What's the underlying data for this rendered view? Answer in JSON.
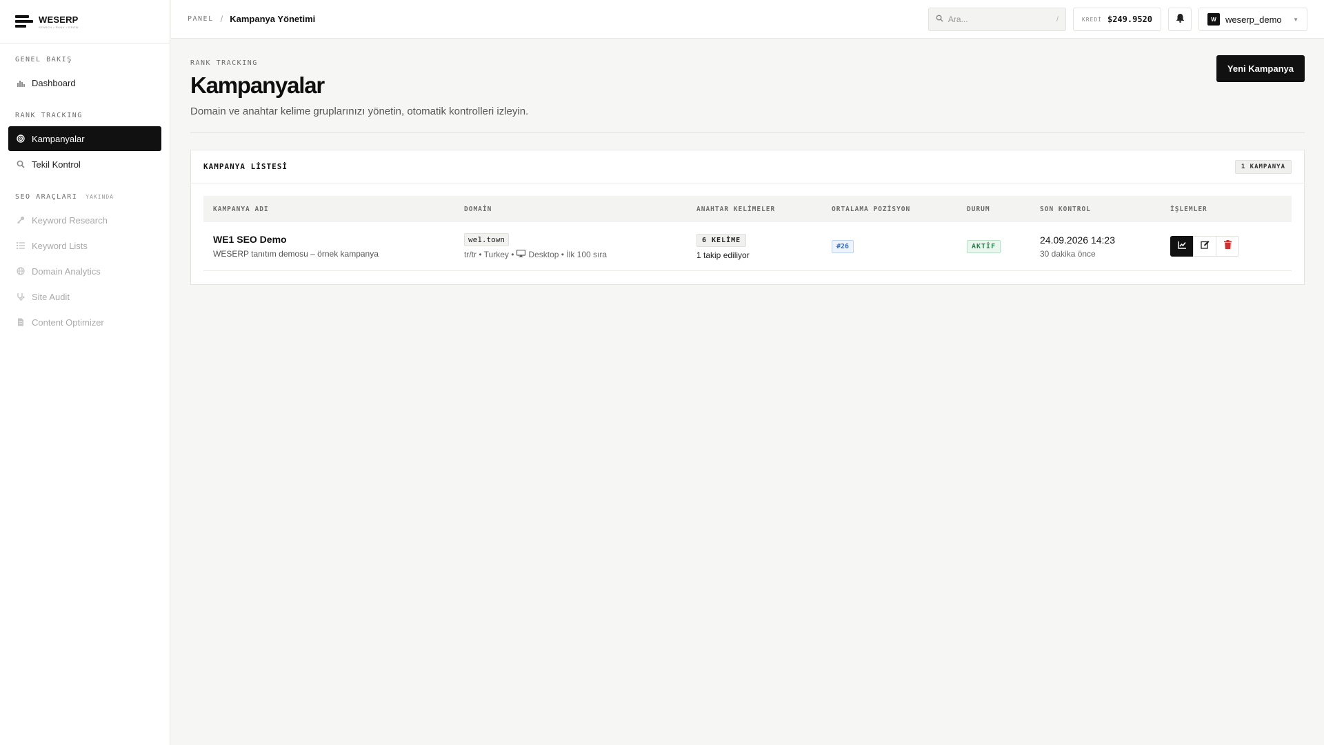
{
  "brand": {
    "name": "WESERP",
    "tagline": "SEARCH • RANK • GROW"
  },
  "sidebar": {
    "sections": [
      {
        "label": "GENEL BAKIŞ",
        "items": [
          {
            "label": "Dashboard",
            "icon": "bar-chart-icon"
          }
        ]
      },
      {
        "label": "RANK TRACKING",
        "items": [
          {
            "label": "Kampanyalar",
            "icon": "target-icon",
            "active": true
          },
          {
            "label": "Tekil Kontrol",
            "icon": "search-icon"
          }
        ]
      },
      {
        "label": "SEO ARAÇLARI",
        "badge": "YAKINDA",
        "items": [
          {
            "label": "Keyword Research",
            "icon": "key-icon"
          },
          {
            "label": "Keyword Lists",
            "icon": "list-icon"
          },
          {
            "label": "Domain Analytics",
            "icon": "globe-icon"
          },
          {
            "label": "Site Audit",
            "icon": "stethoscope-icon"
          },
          {
            "label": "Content Optimizer",
            "icon": "document-icon"
          }
        ]
      }
    ]
  },
  "topbar": {
    "breadcrumb_root": "PANEL",
    "breadcrumb_sep": "/",
    "breadcrumb_current": "Kampanya Yönetimi",
    "search_placeholder": "Ara...",
    "search_shortcut": "/",
    "credit_label": "KREDİ",
    "credit_value": "$249.9520",
    "user_initial": "W",
    "user_name": "weserp_demo"
  },
  "page": {
    "eyebrow": "RANK TRACKING",
    "title": "Kampanyalar",
    "description": "Domain ve anahtar kelime gruplarınızı yönetin, otomatik kontrolleri izleyin.",
    "new_button": "Yeni Kampanya"
  },
  "list": {
    "title": "KAMPANYA LİSTESİ",
    "count": "1 KAMPANYA",
    "columns": [
      "KAMPANYA ADI",
      "DOMAİN",
      "ANAHTAR KELİMELER",
      "ORTALAMA POZİSYON",
      "DURUM",
      "SON KONTROL",
      "İŞLEMLER"
    ],
    "rows": [
      {
        "name": "WE1 SEO Demo",
        "description": "WESERP tanıtım demosu – örnek kampanya",
        "domain": "we1.town",
        "locale": "tr/tr • Turkey •",
        "device": "Desktop • İlk 100 sıra",
        "keywords": "6 KELİME",
        "tracked": "1 takip ediliyor",
        "avg_position": "#26",
        "status": "AKTİF",
        "last_check": "24.09.2026 14:23",
        "last_check_rel": "30 dakika önce"
      }
    ]
  },
  "colors": {
    "accent": "#111111",
    "status_active": "#1f8a4c",
    "position": "#2f6fd1",
    "delete": "#d32f2f"
  }
}
